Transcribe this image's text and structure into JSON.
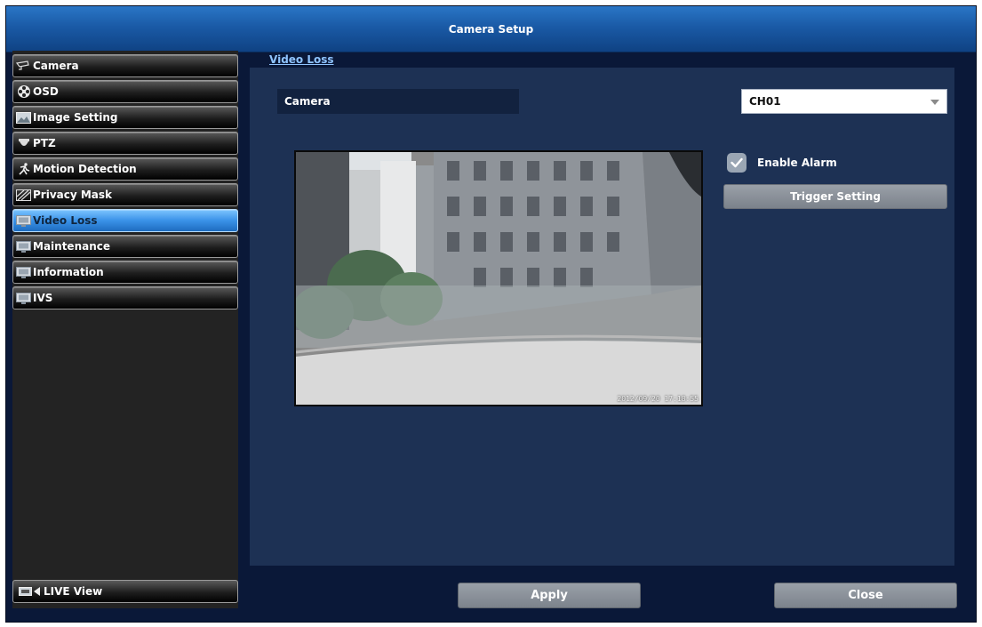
{
  "window": {
    "title": "Camera Setup"
  },
  "sidebar": {
    "items": [
      {
        "label": "Camera",
        "icon": "camera-icon",
        "active": false
      },
      {
        "label": "OSD",
        "icon": "osd-icon",
        "active": false
      },
      {
        "label": "Image Setting",
        "icon": "image-icon",
        "active": false
      },
      {
        "label": "PTZ",
        "icon": "ptz-icon",
        "active": false
      },
      {
        "label": "Motion Detection",
        "icon": "motion-icon",
        "active": false
      },
      {
        "label": "Privacy Mask",
        "icon": "mask-icon",
        "active": false
      },
      {
        "label": "Video Loss",
        "icon": "monitor-icon",
        "active": true
      },
      {
        "label": "Maintenance",
        "icon": "monitor-icon",
        "active": false
      },
      {
        "label": "Information",
        "icon": "monitor-icon",
        "active": false
      },
      {
        "label": "IVS",
        "icon": "monitor-icon",
        "active": false
      }
    ],
    "live_view_label": "LIVE View",
    "live_view_icon": "live-view-icon"
  },
  "main": {
    "section_title": "Video Loss",
    "camera_label": "Camera",
    "channel_select": {
      "value": "CH01"
    },
    "preview": {
      "timestamp": "2012/09/20 17:18:55"
    },
    "enable_alarm": {
      "label": "Enable Alarm",
      "checked": true
    },
    "trigger_setting_label": "Trigger Setting"
  },
  "footer": {
    "apply_label": "Apply",
    "close_label": "Close"
  },
  "colors": {
    "title_bar": "#1a5aa6",
    "window_bg": "#0a1838",
    "panel_bg": "#1d3154",
    "active_menu": "#3a92e8",
    "link": "#8fc4ff",
    "button_gray": "#8b929b"
  }
}
